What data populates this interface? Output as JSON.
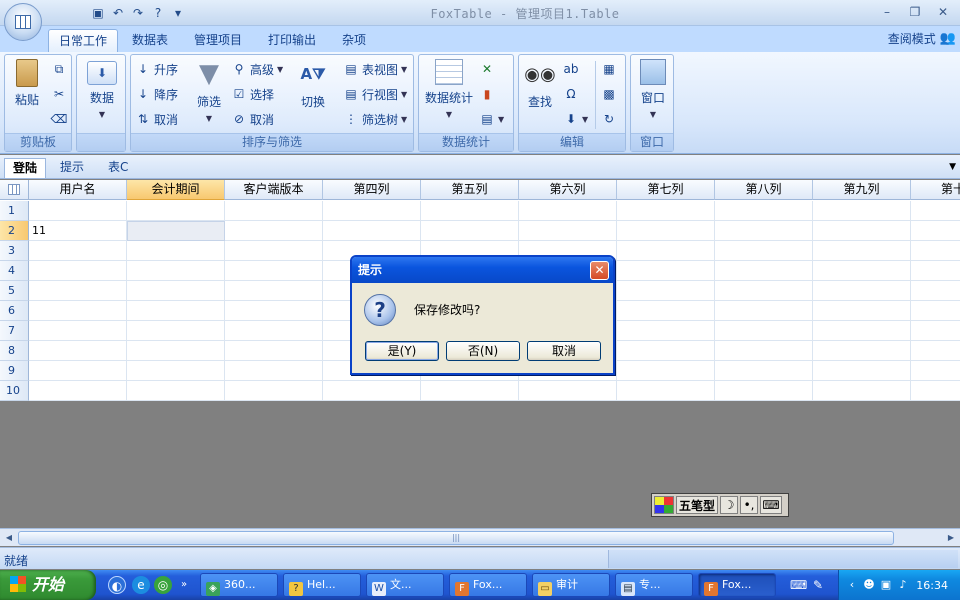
{
  "app": {
    "title": "FoxTable - 管理项目1.Table",
    "view_mode": "查阅模式"
  },
  "ribbon_tabs": [
    "日常工作",
    "数据表",
    "管理项目",
    "打印输出",
    "杂项"
  ],
  "groups": {
    "clipboard": {
      "caption": "剪贴板",
      "paste": "粘贴"
    },
    "data": {
      "caption": "",
      "data": "数据"
    },
    "sort_filter": {
      "caption": "排序与筛选",
      "asc": "升序",
      "desc": "降序",
      "cancel_sort": "取消",
      "filter": "筛选",
      "advanced": "高级",
      "select": "选择",
      "cancel_filter": "取消",
      "switch": "切换",
      "table_view": "表视图",
      "row_view": "行视图",
      "filter_tree": "筛选树"
    },
    "stats": {
      "caption": "数据统计",
      "label": "数据统计"
    },
    "edit": {
      "caption": "编辑",
      "find": "查找"
    },
    "window": {
      "caption": "窗口",
      "label": "窗口"
    }
  },
  "sheet_tabs": [
    "登陆",
    "提示",
    "表C"
  ],
  "grid": {
    "columns": [
      "用户名",
      "会计期间",
      "客户端版本",
      "第四列",
      "第五列",
      "第六列",
      "第七列",
      "第八列",
      "第九列",
      "第十"
    ],
    "rows": [
      "1",
      "2",
      "3",
      "4",
      "5",
      "6",
      "7",
      "8",
      "9",
      "10"
    ],
    "cell_r2_c1": "11"
  },
  "dialog": {
    "title": "提示",
    "message": "保存修改吗?",
    "yes": "是(Y)",
    "no": "否(N)",
    "cancel": "取消"
  },
  "ime": {
    "label": "五笔型"
  },
  "status": {
    "text": "就绪"
  },
  "taskbar": {
    "start": "开始",
    "tasks": [
      "360...",
      "Hel...",
      "文...",
      "Fox...",
      "审计",
      "专...",
      "Fox..."
    ],
    "clock": "16:34"
  }
}
